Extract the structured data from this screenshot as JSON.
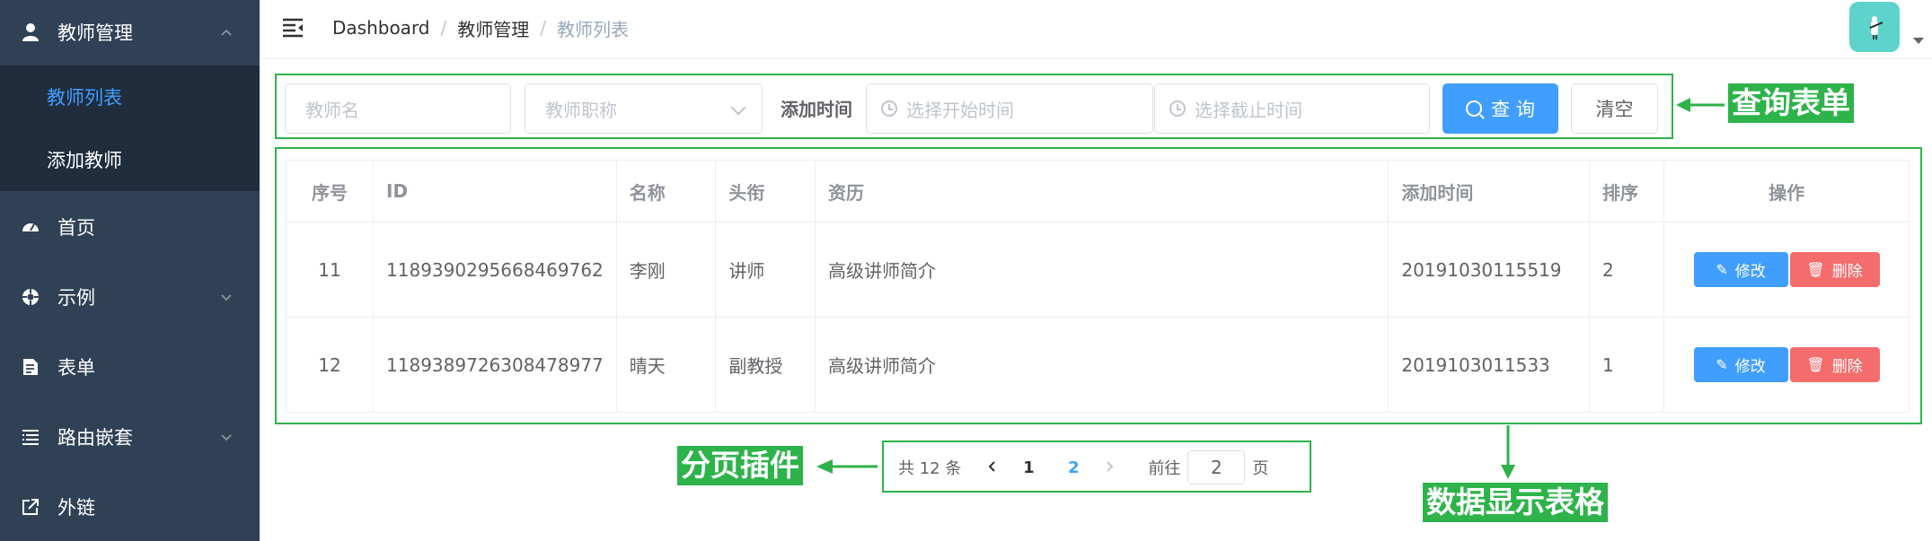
{
  "sidebar": {
    "group_teacher": {
      "label": "教师管理",
      "children": [
        {
          "label": "教师列表",
          "active": true
        },
        {
          "label": "添加教师"
        }
      ]
    },
    "items": [
      {
        "label": "首页",
        "icon": "dashboard-icon"
      },
      {
        "label": "示例",
        "icon": "example-icon"
      },
      {
        "label": "表单",
        "icon": "form-icon"
      },
      {
        "label": "路由嵌套",
        "icon": "nested-icon"
      },
      {
        "label": "外链",
        "icon": "link-icon"
      }
    ]
  },
  "navbar": {
    "breadcrumb": [
      "Dashboard",
      "教师管理",
      "教师列表"
    ]
  },
  "query_form": {
    "name_placeholder": "教师名",
    "level_placeholder": "教师职称",
    "time_label": "添加时间",
    "begin_placeholder": "选择开始时间",
    "end_placeholder": "选择截止时间",
    "query_button": "查 询",
    "clear_button": "清空"
  },
  "table": {
    "columns": [
      "序号",
      "ID",
      "名称",
      "头衔",
      "资历",
      "添加时间",
      "排序",
      "操作"
    ],
    "rows": [
      {
        "index": "11",
        "id": "1189390295668469762",
        "name": "李刚",
        "title": "讲师",
        "intro": "高级讲师简介",
        "time": "20191030115519",
        "sort": "2"
      },
      {
        "index": "12",
        "id": "1189389726308478977",
        "name": "晴天",
        "title": "副教授",
        "intro": "高级讲师简介",
        "time": "2019103011533",
        "sort": "1"
      }
    ],
    "edit_label": "修改",
    "delete_label": "删除"
  },
  "pagination": {
    "total": "共 12 条",
    "pages": [
      "1",
      "2"
    ],
    "current_page": "2",
    "goto_label": "前往",
    "goto_value": "2",
    "page_unit": "页"
  },
  "annotations": {
    "form": "查询表单",
    "table": "数据显示表格",
    "pager": "分页插件"
  },
  "colors": {
    "sidebar_bg": "#304156",
    "submenu_bg": "#1f2d3d",
    "primary": "#409eff",
    "danger": "#f56c6c",
    "annotation": "#2db34a",
    "avatar_bg": "#5dd3cb"
  }
}
